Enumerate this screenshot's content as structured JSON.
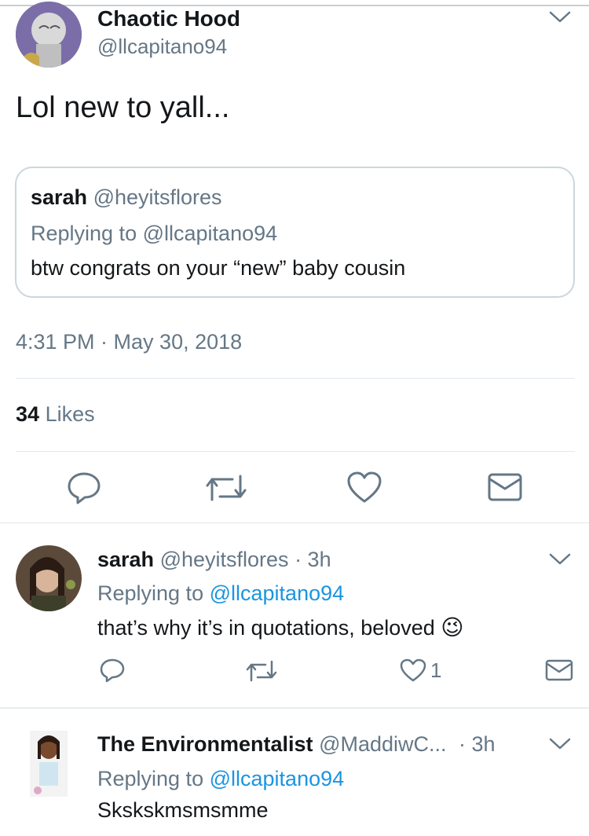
{
  "main_tweet": {
    "display_name": "Chaotic Hood",
    "handle": "@llcapitano94",
    "text": "Lol new to yall...",
    "timestamp": "4:31 PM · May 30, 2018",
    "likes_count": "34",
    "likes_label": "Likes"
  },
  "quoted_tweet": {
    "display_name": "sarah",
    "handle": "@heyitsflores",
    "replying_prefix": "Replying to",
    "replying_handle": "@llcapitano94",
    "text": "btw congrats on your “new” baby cousin"
  },
  "replies": [
    {
      "display_name": "sarah",
      "handle": "@heyitsflores",
      "time": "· 3h",
      "replying_prefix": "Replying to",
      "replying_handle": "@llcapitano94",
      "text": "that’s why it’s in quotations, beloved",
      "emoji": "😉",
      "like_count": "1"
    },
    {
      "display_name": "The Environmentalist",
      "handle": "@MaddiwC...",
      "time": "· 3h",
      "replying_prefix": "Replying to",
      "replying_handle": "@llcapitano94",
      "text": "Skskskmsmsmme"
    }
  ],
  "icons": {
    "reply": "speech-bubble-icon",
    "retweet": "retweet-icon",
    "like": "heart-icon",
    "share": "envelope-icon",
    "more": "chevron-down-icon"
  },
  "colors": {
    "link": "#1b95e0",
    "secondary_text": "#657786",
    "icon": "#657786",
    "border": "#ccd6dd"
  }
}
